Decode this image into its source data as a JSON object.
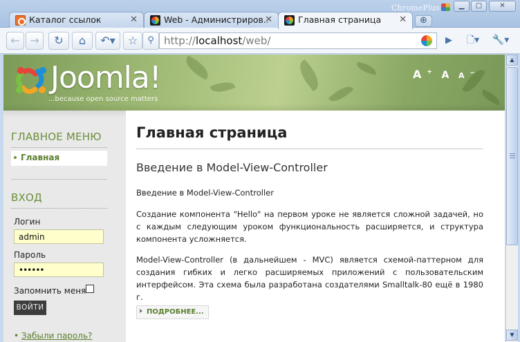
{
  "browser": {
    "brand": "ChromePlus",
    "tabs": [
      {
        "label": "Каталог ссылок",
        "active": false
      },
      {
        "label": "Web - Администриров...",
        "active": false
      },
      {
        "label": "Главная страница",
        "active": true
      }
    ],
    "url": {
      "scheme": "http://",
      "host": "localhost",
      "path": "/web/"
    }
  },
  "header": {
    "logo": "Joomla!",
    "trademark": "™",
    "tagline": "...because open source matters",
    "font_sizer": {
      "large": "A",
      "normal": "A",
      "small": "A"
    }
  },
  "sidebar": {
    "main_menu": {
      "title": "ГЛАВНОЕ МЕНЮ",
      "items": [
        {
          "label": "Главная"
        }
      ]
    },
    "login": {
      "title": "ВХОД",
      "username_label": "Логин",
      "username_value": "admin",
      "password_label": "Пароль",
      "password_value": "••••••",
      "remember_label": "Запомнить меня",
      "submit_label": "ВОЙТИ",
      "forgot_password": "Забыли пароль?"
    }
  },
  "content": {
    "page_title": "Главная страница",
    "article_title": "Введение в Model-View-Controller",
    "paragraphs": [
      "Введение в Model-View-Controller",
      "Создание компонента \"Hello\" на первом уроке не является сложной задачей, но с каждым следующим уроком функциональность расширяется, и структура компонента усложняется.",
      "Model-View-Controller (в дальнейшем - MVC) является схемой-паттерном для создания гибких и легко расширяемых приложений с пользовательским интерфейсом. Эта схема была разработана создателями Smalltalk-80 ещё в 1980 г."
    ],
    "read_more": "ПОДРОБНЕЕ..."
  }
}
